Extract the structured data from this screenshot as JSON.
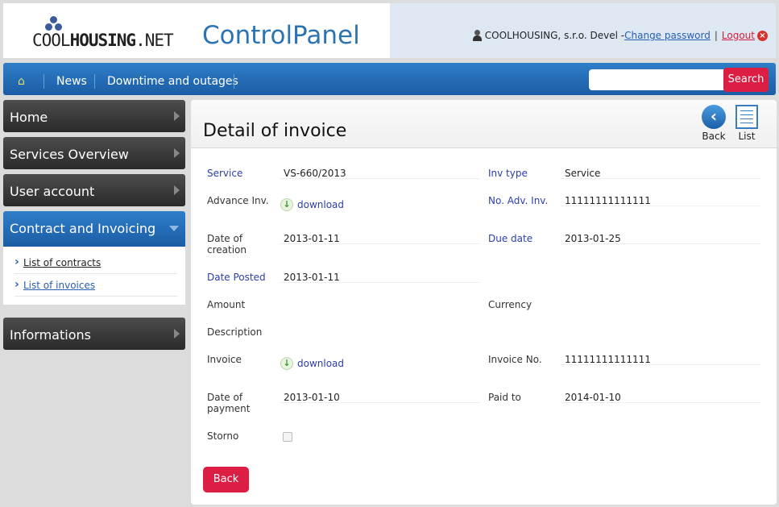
{
  "header": {
    "logo_text_light": "COOL",
    "logo_text_bold": "HOUSING",
    "logo_text_suffix": ".NET",
    "app_title": "ControlPanel",
    "user_text": "COOLHOUSING, s.r.o. Devel -",
    "change_password": "Change password",
    "separator": "|",
    "logout": "Logout"
  },
  "nav": {
    "home_icon": "home-icon",
    "items": [
      "News",
      "Downtime and outages"
    ],
    "search_placeholder": "",
    "search_button": "Search"
  },
  "sidebar": {
    "items": [
      {
        "label": "Home",
        "active": false
      },
      {
        "label": "Services Overview",
        "active": false
      },
      {
        "label": "User account",
        "active": false
      },
      {
        "label": "Contract and Invoicing",
        "active": true
      },
      {
        "label": "Informations",
        "active": false
      }
    ],
    "submenu": [
      "List of contracts",
      "List of invoices"
    ]
  },
  "main": {
    "title": "Detail of invoice",
    "back_label": "Back",
    "list_label": "List",
    "bottom_back": "Back",
    "download_label": "download",
    "fields": {
      "service": {
        "label": "Service",
        "value": "VS-660/2013"
      },
      "inv_type": {
        "label": "Inv type",
        "value": "Service"
      },
      "advance_inv": {
        "label": "Advance Inv."
      },
      "no_adv_inv": {
        "label": "No. Adv. Inv.",
        "value": "11111111111111"
      },
      "date_of_creation": {
        "label_1": "Date of",
        "label_2": "creation",
        "value": "2013-01-11"
      },
      "due_date": {
        "label": "Due date",
        "value": "2013-01-25"
      },
      "date_posted": {
        "label": "Date Posted",
        "value": "2013-01-11"
      },
      "amount": {
        "label": "Amount"
      },
      "currency": {
        "label": "Currency"
      },
      "description": {
        "label": "Description"
      },
      "invoice": {
        "label": "Invoice"
      },
      "invoice_no": {
        "label": "Invoice No.",
        "value": "11111111111111"
      },
      "date_of_payment": {
        "label_1": "Date of",
        "label_2": "payment",
        "value": "2013-01-10"
      },
      "paid_to": {
        "label": "Paid to",
        "value": "2014-01-10"
      },
      "storno": {
        "label": "Storno",
        "checked": false
      }
    }
  },
  "colors": {
    "brand_blue": "#2a74b4",
    "nav_blue": "#1b5da5",
    "accent_red": "#dc1e45",
    "label_blue": "#2b3ea8"
  }
}
